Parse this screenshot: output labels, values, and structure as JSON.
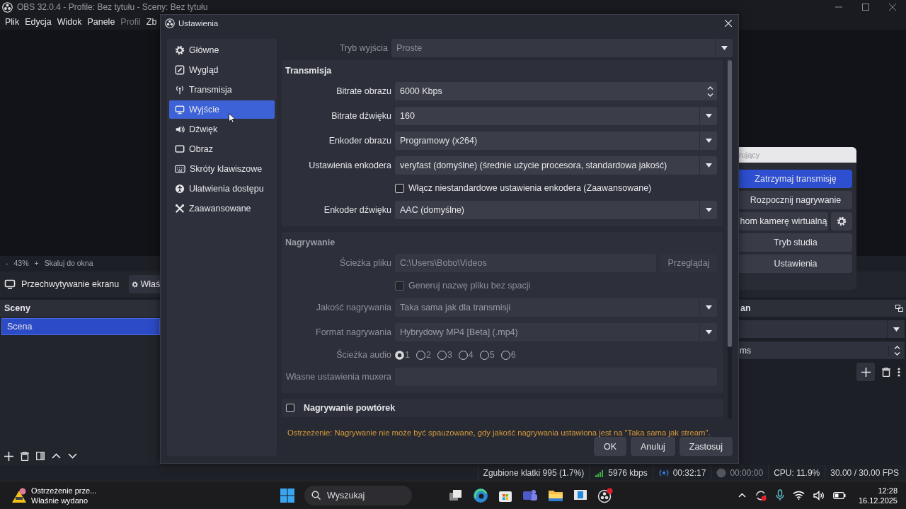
{
  "app": {
    "title": "OBS 32.0.4 - Profile: Bez tytułu - Sceny: Bez tytułu",
    "menu": [
      {
        "label": "Plik",
        "disabled": false
      },
      {
        "label": "Edycja",
        "disabled": false
      },
      {
        "label": "Widok",
        "disabled": false
      },
      {
        "label": "Panele",
        "disabled": false
      },
      {
        "label": "Profil",
        "disabled": true
      },
      {
        "label": "Zb",
        "disabled": false
      }
    ]
  },
  "preview_toolbar": {
    "zoom_out": "-",
    "zoom": "43%",
    "zoom_in": "+",
    "fit": "Skaluj do okna"
  },
  "source_bar": {
    "source": "Przechwytywanie ekranu",
    "properties": "Właś"
  },
  "scenes": {
    "title": "Sceny",
    "items": [
      {
        "label": "Scena",
        "selected": true
      }
    ]
  },
  "controls": {
    "title": "rujący",
    "buttons": [
      {
        "label": "Zatrzymaj transmisję",
        "active": true,
        "settings": false
      },
      {
        "label": "Rozpocznij nagrywanie",
        "active": false,
        "settings": false
      },
      {
        "label": "hom kamerę wirtualną",
        "active": false,
        "settings": true
      },
      {
        "label": "Tryb studia",
        "active": false,
        "settings": false
      },
      {
        "label": "Ustawienia",
        "active": false,
        "settings": false
      }
    ]
  },
  "mixer_dock": {
    "title": "an",
    "duration": "ms"
  },
  "status_bar": {
    "dropped": "Zgubione klatki 995 (1.7%)",
    "bitrate": "5976 kbps",
    "stream_time": "00:32:17",
    "recording": false,
    "record_time": "00:00:00",
    "cpu": "CPU: 11.9%",
    "fps": "30.00 / 30.00 FPS"
  },
  "dialog": {
    "title": "Ustawienia",
    "nav": [
      {
        "label": "Główne",
        "kind": "general",
        "selected": false
      },
      {
        "label": "Wygląd",
        "kind": "appearance",
        "selected": false
      },
      {
        "label": "Transmisja",
        "kind": "stream",
        "selected": false
      },
      {
        "label": "Wyjście",
        "kind": "output",
        "selected": true
      },
      {
        "label": "Dźwięk",
        "kind": "audio",
        "selected": false
      },
      {
        "label": "Obraz",
        "kind": "video",
        "selected": false
      },
      {
        "label": "Skróty klawiszowe",
        "kind": "hotkeys",
        "selected": false
      },
      {
        "label": "Ułatwienia dostępu",
        "kind": "accessibility",
        "selected": false
      },
      {
        "label": "Zaawansowane",
        "kind": "advanced",
        "selected": false
      }
    ],
    "output_mode": {
      "label": "Tryb wyjścia",
      "value": "Proste",
      "disabled": true
    },
    "groups": [
      {
        "title": "Transmisja",
        "disabled": false,
        "fields": [
          {
            "kind": "spin",
            "label": "Bitrate obrazu",
            "value": "6000 Kbps"
          },
          {
            "kind": "select",
            "label": "Bitrate dźwięku",
            "value": "160"
          },
          {
            "kind": "select",
            "label": "Enkoder obrazu",
            "value": "Programowy (x264)"
          },
          {
            "kind": "select",
            "label": "Ustawienia enkodera",
            "value": "veryfast (domyślne) (średnie użycie procesora, standardowa jakość)"
          },
          {
            "kind": "checkbox",
            "label": "Włącz niestandardowe ustawienia enkodera (Zaawansowane)",
            "checked": false
          },
          {
            "kind": "select",
            "label": "Enkoder dźwięku",
            "value": "AAC (domyślne)"
          }
        ]
      },
      {
        "title": "Nagrywanie",
        "disabled": true,
        "fields": [
          {
            "kind": "path",
            "label": "Ścieżka pliku",
            "value": "C:\\Users\\Bobo\\Videos",
            "button": "Przeglądaj"
          },
          {
            "kind": "checkbox",
            "label": "Generuj nazwę pliku bez spacji",
            "checked": false
          },
          {
            "kind": "select",
            "label": "Jakość nagrywania",
            "value": "Taka sama jak dla transmisji"
          },
          {
            "kind": "select",
            "label": "Format nagrywania",
            "value": "Hybrydowy MP4 [Beta] (.mp4)"
          },
          {
            "kind": "radio",
            "label": "Ścieżka audio",
            "options": [
              {
                "label": "1",
                "selected": true
              },
              {
                "label": "2",
                "selected": false
              },
              {
                "label": "3",
                "selected": false
              },
              {
                "label": "4",
                "selected": false
              },
              {
                "label": "5",
                "selected": false
              },
              {
                "label": "6",
                "selected": false
              }
            ]
          },
          {
            "kind": "text",
            "label": "Własne ustawienia muxera"
          }
        ]
      }
    ],
    "replay": {
      "label": "Nagrywanie powtórek",
      "checked": false
    },
    "warning": "Ostrzeżenie: Nagrywanie nie może być spauzowane, gdy jakość nagrywania ustawiona jest na \"Taka sama jak stream\".",
    "buttons": [
      "OK",
      "Anuluj",
      "Zastosuj"
    ]
  },
  "taskbar": {
    "notification": {
      "title": "Ostrzeżenie prze...",
      "subtitle": "Właśnie wydano"
    },
    "search": "Wyszukaj",
    "time": "12:28",
    "date": "16.12.2025"
  }
}
